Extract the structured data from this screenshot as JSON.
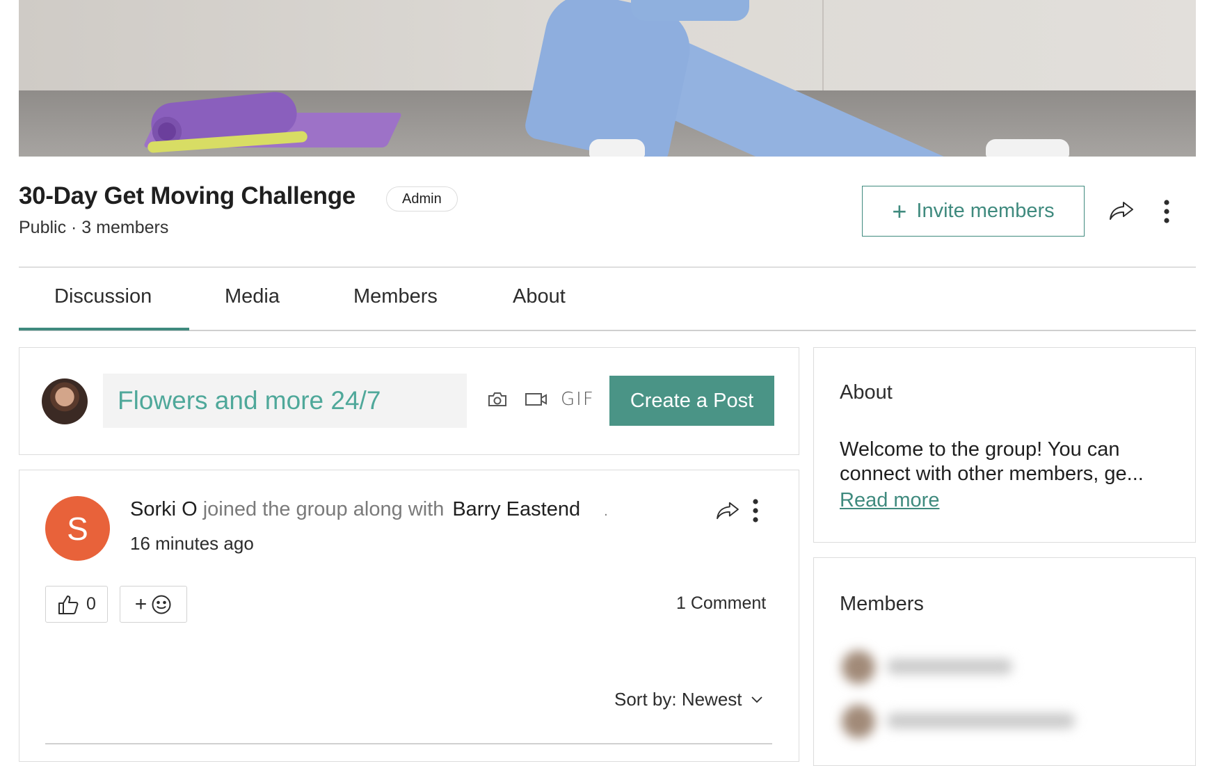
{
  "cover": {
    "image_name": "cover-photo"
  },
  "group": {
    "title": "30-Day Get Moving Challenge",
    "role_badge": "Admin",
    "meta": "Public · 3 members"
  },
  "header_actions": {
    "invite_label": "Invite members",
    "invite_icon": "plus-icon",
    "share_icon": "share-icon",
    "more_icon": "more-vertical-icon"
  },
  "tabs": [
    {
      "label": "Discussion",
      "active": true
    },
    {
      "label": "Media",
      "active": false
    },
    {
      "label": "Members",
      "active": false
    },
    {
      "label": "About",
      "active": false
    }
  ],
  "composer": {
    "input_text": "Flowers and more 24/7",
    "gif_label": "GIF",
    "create_post_label": "Create a Post",
    "icons": [
      "camera-icon",
      "video-icon"
    ]
  },
  "post": {
    "avatar_letter": "S",
    "author": "Sorki O",
    "action_text": "joined the group along with",
    "other_member": "Barry Eastend",
    "trailing": ".",
    "time": "16 minutes ago",
    "like_count": "0",
    "react_plus": "+",
    "comment_count_label": "1 Comment",
    "sort_label": "Sort by: Newest"
  },
  "sidebar": {
    "about_title": "About",
    "about_text": "Welcome to the group! You can connect with other members, ge...",
    "read_more_label": "Read more",
    "members_title": "Members"
  },
  "colors": {
    "accent": "#3f8a7e",
    "button_fill": "#4a9486",
    "avatar_orange": "#e8623a",
    "input_text": "#4fa89a"
  }
}
